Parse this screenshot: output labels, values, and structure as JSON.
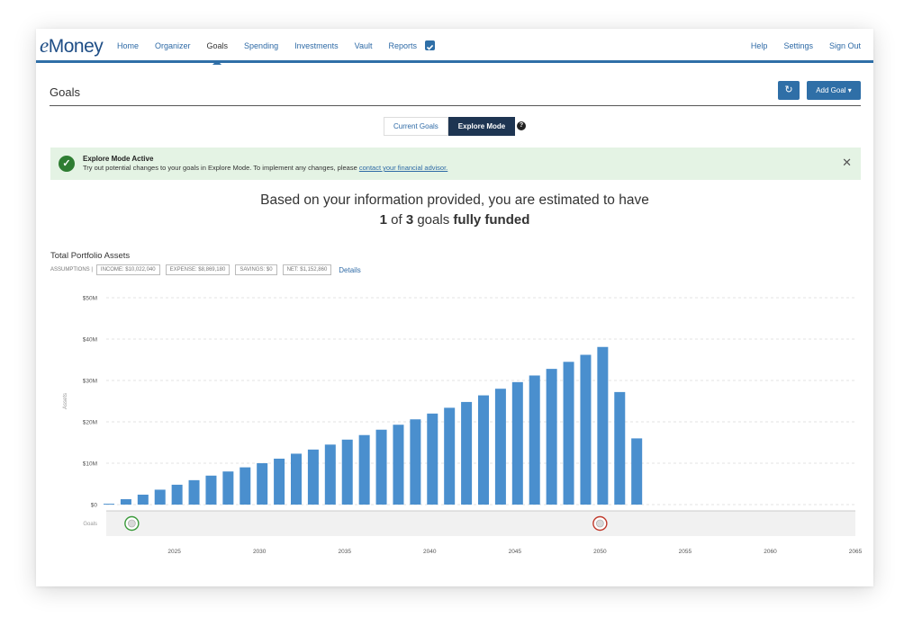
{
  "nav": {
    "logo_e": "e",
    "logo_rest": "Money",
    "items": [
      {
        "label": "Home"
      },
      {
        "label": "Organizer"
      },
      {
        "label": "Goals",
        "active": true
      },
      {
        "label": "Spending"
      },
      {
        "label": "Investments"
      },
      {
        "label": "Vault"
      },
      {
        "label": "Reports"
      }
    ],
    "check_icon": "checkbox-icon",
    "right_items": [
      {
        "label": "Help"
      },
      {
        "label": "Settings"
      },
      {
        "label": "Sign Out"
      }
    ]
  },
  "header": {
    "title": "Goals",
    "refresh_icon": "refresh-icon",
    "refresh_glyph": "↻",
    "add_goal_label": "Add Goal ▾"
  },
  "toggle": {
    "current_label": "Current Goals",
    "explore_label": "Explore Mode",
    "help_glyph": "?"
  },
  "alert": {
    "check_glyph": "✓",
    "title": "Explore Mode Active",
    "text": "Try out potential changes to your goals in Explore Mode. To implement any changes, please ",
    "link": "contact your financial advisor.",
    "close_glyph": "✕"
  },
  "summary": {
    "line1": "Based on your information provided, you are estimated to have",
    "funded": "1",
    "of": " of ",
    "total": "3",
    "goals_word": " goals ",
    "fully_funded": "fully funded"
  },
  "portfolio": {
    "title": "Total Portfolio Assets",
    "assumptions_label": "ASSUMPTIONS |",
    "income": "INCOME: $10,022,040",
    "expense": "EXPENSE: $8,869,180",
    "savings": "SAVINGS: $0",
    "net": "NET: $1,152,860",
    "details_label": "Details"
  },
  "colors": {
    "bar": "#4a8fce",
    "grid": "#e3e3e3",
    "goal_green": "#3a9a3a",
    "goal_red": "#c0392b"
  },
  "chart_data": {
    "type": "bar",
    "ylabel": "Assets",
    "ylim": [
      0,
      50
    ],
    "yticks": [
      "$0",
      "$10M",
      "$20M",
      "$30M",
      "$40M",
      "$50M"
    ],
    "ytick_values": [
      0,
      10,
      20,
      30,
      40,
      50
    ],
    "xlim": [
      2021,
      2065
    ],
    "xticks": [
      2025,
      2030,
      2035,
      2040,
      2045,
      2050,
      2055,
      2060,
      2065
    ],
    "x": [
      2021,
      2022,
      2023,
      2024,
      2025,
      2026,
      2027,
      2028,
      2029,
      2030,
      2031,
      2032,
      2033,
      2034,
      2035,
      2036,
      2037,
      2038,
      2039,
      2040,
      2041,
      2042,
      2043,
      2044,
      2045,
      2046,
      2047,
      2048,
      2049,
      2050,
      2051,
      2052
    ],
    "values": [
      0.2,
      1.3,
      2.4,
      3.6,
      4.8,
      5.9,
      7.0,
      8.0,
      9.0,
      10.0,
      11.1,
      12.3,
      13.3,
      14.5,
      15.7,
      16.8,
      18.1,
      19.3,
      20.6,
      22.0,
      23.4,
      24.8,
      26.4,
      28.0,
      29.6,
      31.2,
      32.8,
      34.5,
      36.2,
      38.1,
      27.2,
      16.0
    ],
    "goals_label": "Goals",
    "goal_markers": [
      {
        "year": 2022.5,
        "status": "funded",
        "color": "#3a9a3a"
      },
      {
        "year": 2050,
        "status": "not-funded",
        "color": "#c0392b"
      }
    ]
  }
}
